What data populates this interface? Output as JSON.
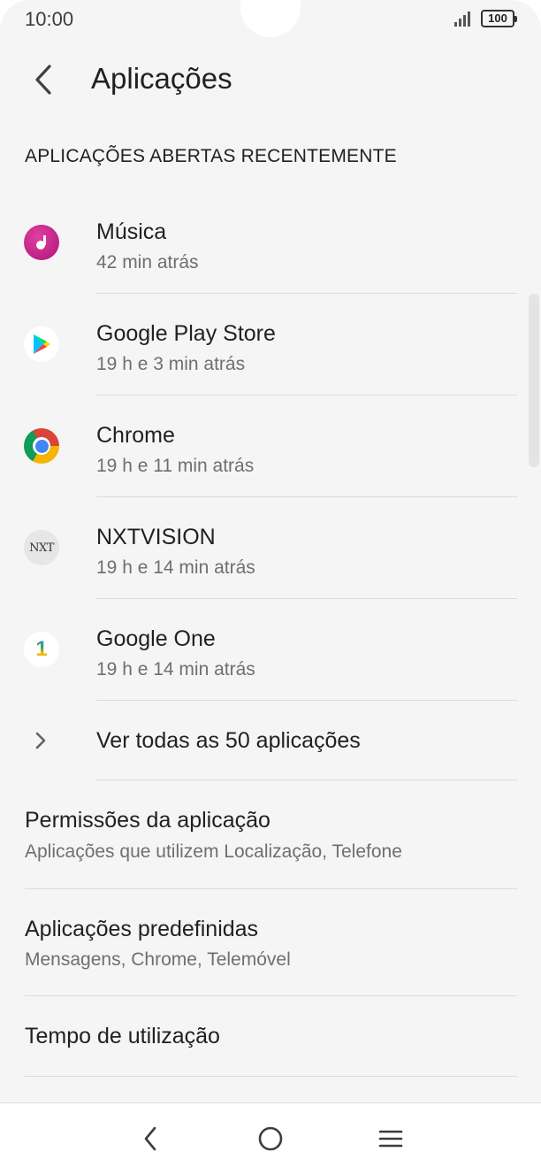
{
  "status_bar": {
    "time": "10:00",
    "battery": "100"
  },
  "header": {
    "title": "Aplicações"
  },
  "recent": {
    "section_title": "APLICAÇÕES ABERTAS RECENTEMENTE",
    "apps": [
      {
        "name": "Música",
        "time": "42 min atrás",
        "icon": "music-icon"
      },
      {
        "name": "Google Play Store",
        "time": "19 h e 3 min atrás",
        "icon": "play-store-icon"
      },
      {
        "name": "Chrome",
        "time": "19 h e 11 min atrás",
        "icon": "chrome-icon"
      },
      {
        "name": "NXTVISION",
        "time": "19 h e 14 min atrás",
        "icon": "nxtvision-icon",
        "icon_text": "NXT"
      },
      {
        "name": "Google One",
        "time": "19 h e 14 min atrás",
        "icon": "google-one-icon",
        "icon_text": "1"
      }
    ],
    "see_all": "Ver todas as 50 aplicações"
  },
  "settings": [
    {
      "title": "Permissões da aplicação",
      "subtitle": "Aplicações que utilizem Localização, Telefone"
    },
    {
      "title": "Aplicações predefinidas",
      "subtitle": "Mensagens, Chrome, Telemóvel"
    },
    {
      "title": "Tempo de utilização"
    }
  ],
  "colors": {
    "background": "#f5f5f5",
    "music": "#c2185b",
    "chrome_red": "#db4437",
    "chrome_yellow": "#f4b400",
    "chrome_green": "#0f9d58",
    "chrome_blue": "#4285f4"
  }
}
